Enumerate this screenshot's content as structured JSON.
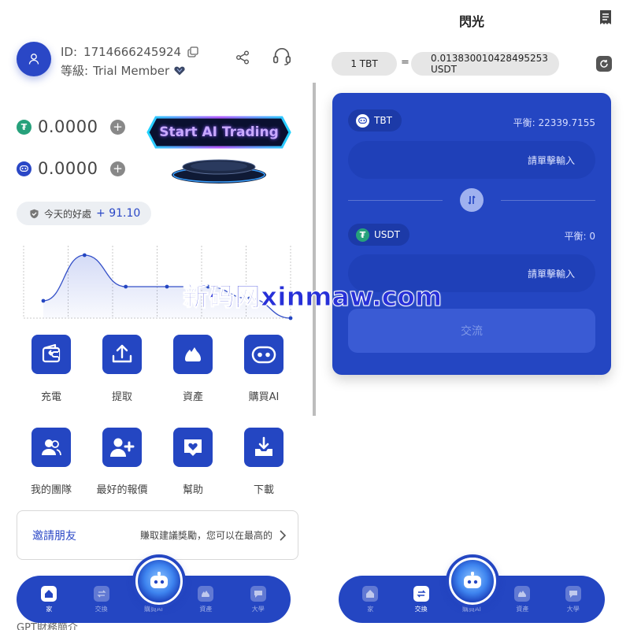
{
  "profile": {
    "id_label": "ID:",
    "id_value": "1714666245924",
    "level_label": "等級:",
    "level_value": "Trial Member"
  },
  "balances": [
    {
      "coin": "usdt",
      "value": "0.0000"
    },
    {
      "coin": "tbt",
      "value": "0.0000"
    }
  ],
  "ai_trading": {
    "label": "Start AI Trading"
  },
  "profit": {
    "label": "今天的好處",
    "value": "+ 91.10"
  },
  "chart_data": {
    "type": "line",
    "x": [
      1,
      2,
      3,
      4,
      5,
      6,
      7
    ],
    "values": [
      2.2,
      8.0,
      4.0,
      4.0,
      4.0,
      2.5,
      0.0
    ],
    "ylim": [
      0,
      9
    ],
    "grid": "vertical dotted",
    "fill": "area under line"
  },
  "grid_row1": [
    {
      "icon": "wallet-deposit-icon",
      "label": "充電"
    },
    {
      "icon": "upload-icon",
      "label": "提取"
    },
    {
      "icon": "assets-icon",
      "label": "資產"
    },
    {
      "icon": "robot-icon",
      "label": "購買AI"
    }
  ],
  "grid_row2": [
    {
      "icon": "team-icon",
      "label": "我的團隊"
    },
    {
      "icon": "add-user-icon",
      "label": "最好的報價"
    },
    {
      "icon": "help-icon",
      "label": "幫助"
    },
    {
      "icon": "download-icon",
      "label": "下載"
    }
  ],
  "invite": {
    "title": "邀請朋友",
    "desc": "賺取建議獎勵，您可以在最高的"
  },
  "gpt_section": {
    "label": "GPT財務簡介"
  },
  "nav": {
    "items": [
      "家",
      "交換",
      "購買AI",
      "資產",
      "大學"
    ]
  },
  "swap": {
    "title": "閃光",
    "rate_left": "1 TBT",
    "rate_eq": "=",
    "rate_right_line1": "0.013830010428495253",
    "rate_right_line2": "USDT",
    "from_token": "TBT",
    "from_balance": "平衡:  22339.7155",
    "from_placeholder": "請單擊輸入",
    "to_token": "USDT",
    "to_balance": "平衡:  0",
    "to_placeholder": "請單擊輸入",
    "exchange_label": "交流"
  },
  "watermark": "新码网xinmaw.com",
  "colors": {
    "brand": "#2446c2",
    "accent": "#2a47c6",
    "usdt": "#26a17b"
  }
}
